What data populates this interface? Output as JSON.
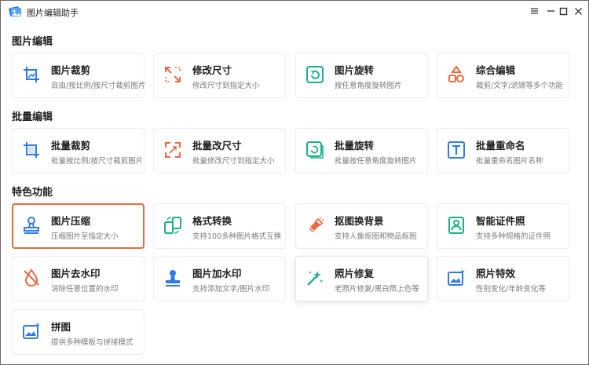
{
  "app": {
    "title": "图片编辑助手",
    "icon": "app-logo-icon"
  },
  "window_controls": [
    {
      "name": "menu-icon"
    },
    {
      "name": "minimize-icon"
    },
    {
      "name": "maximize-icon"
    },
    {
      "name": "close-icon"
    }
  ],
  "sections": [
    {
      "title": "图片编辑",
      "cards": [
        {
          "title": "图片裁剪",
          "desc": "自由/按比例/按尺寸裁剪图片",
          "icon": "crop-icon",
          "color": "#2f7be6"
        },
        {
          "title": "修改尺寸",
          "desc": "修改尺寸到指定大小",
          "icon": "resize-icon",
          "color": "#e96a42"
        },
        {
          "title": "图片旋转",
          "desc": "按任意角度旋转图片",
          "icon": "rotate-icon",
          "color": "#1bb08a"
        },
        {
          "title": "综合编辑",
          "desc": "裁剪/文字/滤镜等多个功能",
          "icon": "shapes-icon",
          "color": "#e96a42"
        }
      ]
    },
    {
      "title": "批量编辑",
      "cards": [
        {
          "title": "批量裁剪",
          "desc": "批量按比例/按尺寸裁剪图片",
          "icon": "batch-crop-icon",
          "color": "#2f7be6"
        },
        {
          "title": "批量改尺寸",
          "desc": "批量修改尺寸到指定大小",
          "icon": "batch-resize-icon",
          "color": "#e96a42"
        },
        {
          "title": "批量旋转",
          "desc": "批量按任意角度旋转图片",
          "icon": "batch-rotate-icon",
          "color": "#1bb08a"
        },
        {
          "title": "批量重命名",
          "desc": "批量重命名图片名称",
          "icon": "rename-icon",
          "color": "#2f7be6"
        }
      ]
    },
    {
      "title": "特色功能",
      "cards": [
        {
          "title": "图片压缩",
          "desc": "压缩图片至指定大小",
          "icon": "compress-stamp-icon",
          "color": "#2f7be6"
        },
        {
          "title": "格式转换",
          "desc": "支持100多种图片格式互换",
          "icon": "convert-icon",
          "color": "#1bb08a"
        },
        {
          "title": "抠图换背景",
          "desc": "支持人像抠图和物品抠图",
          "icon": "eraser-icon",
          "color": "#e96a42"
        },
        {
          "title": "智能证件照",
          "desc": "支持多种规格的证件照",
          "icon": "id-photo-icon",
          "color": "#1bb08a"
        },
        {
          "title": "图片去水印",
          "desc": "消除任意位置的水印",
          "icon": "drop-off-icon",
          "color": "#e96a42"
        },
        {
          "title": "图片加水印",
          "desc": "支持添加文字/图片水印",
          "icon": "watermark-stamp-icon",
          "color": "#2f7be6"
        },
        {
          "title": "照片修复",
          "desc": "老照片修复/黑白照上色等",
          "icon": "magic-wand-icon",
          "color": "#1bb08a"
        },
        {
          "title": "照片特效",
          "desc": "性别变化/年龄变化等",
          "icon": "photo-effect-icon",
          "color": "#2f7be6"
        },
        {
          "title": "拼图",
          "desc": "提供多种模板与拼接模式",
          "icon": "collage-icon",
          "color": "#2f7be6"
        }
      ]
    }
  ]
}
